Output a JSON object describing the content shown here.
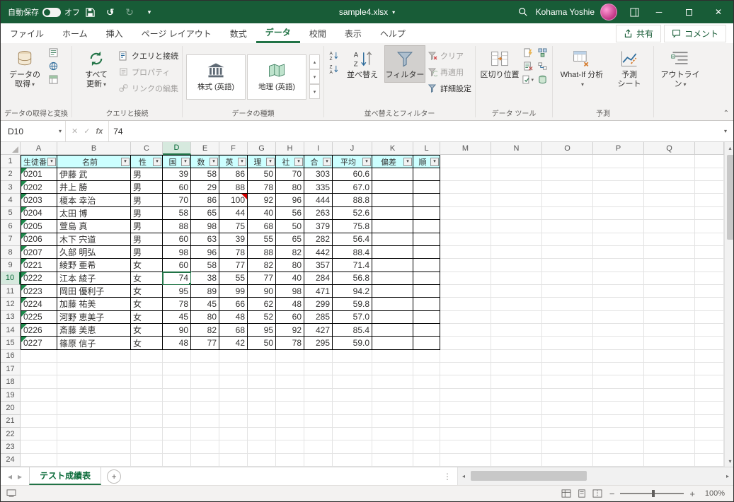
{
  "title_bar": {
    "autosave_label": "自動保存",
    "autosave_state": "オフ",
    "filename": "sample4.xlsx",
    "user_name": "Kohama Yoshie"
  },
  "ribbon_tabs": {
    "file": "ファイル",
    "tabs": [
      "ホーム",
      "挿入",
      "ページ レイアウト",
      "数式",
      "データ",
      "校閲",
      "表示",
      "ヘルプ"
    ],
    "active": "データ",
    "share_label": "共有",
    "comments_label": "コメント"
  },
  "ribbon": {
    "g1_label": "データの取得と変換",
    "get_data_l1": "データの",
    "get_data_l2": "取得",
    "g2_label": "クエリと接続",
    "refresh_l1": "すべて",
    "refresh_l2": "更新",
    "queries_connections": "クエリと接続",
    "properties": "プロパティ",
    "edit_links": "リンクの編集",
    "g3_label": "データの種類",
    "stocks": "株式 (英語)",
    "geography": "地理 (英語)",
    "g4_label": "並べ替えとフィルター",
    "sort": "並べ替え",
    "filter": "フィルター",
    "clear": "クリア",
    "reapply": "再適用",
    "advanced": "詳細設定",
    "g5_label": "データ ツール",
    "text_to_columns": "区切り位置",
    "g6_label": "予測",
    "whatif": "What-If 分析",
    "forecast_l1": "予測",
    "forecast_l2": "シート",
    "outline_l1": "アウトライ",
    "outline_l2": "ン"
  },
  "formula_bar": {
    "name_box": "D10",
    "cancel": "✕",
    "enter": "✓",
    "fx": "fx",
    "value": "74"
  },
  "grid": {
    "col_letters": [
      "A",
      "B",
      "C",
      "D",
      "E",
      "F",
      "G",
      "H",
      "I",
      "J",
      "K",
      "L",
      "M",
      "N",
      "O",
      "P",
      "Q",
      ""
    ],
    "num_rows": 24,
    "filter_headers": [
      "生徒番",
      "名前",
      "性",
      "国",
      "数",
      "英",
      "理",
      "社",
      "合",
      "平均",
      "偏差",
      "順"
    ],
    "rows": [
      [
        "0201",
        "伊藤 武",
        "男",
        "39",
        "58",
        "86",
        "50",
        "70",
        "303",
        "60.6"
      ],
      [
        "0202",
        "井上 勝",
        "男",
        "60",
        "29",
        "88",
        "78",
        "80",
        "335",
        "67.0"
      ],
      [
        "0203",
        "榎本 幸治",
        "男",
        "70",
        "86",
        "100",
        "92",
        "96",
        "444",
        "88.8"
      ],
      [
        "0204",
        "太田 博",
        "男",
        "58",
        "65",
        "44",
        "40",
        "56",
        "263",
        "52.6"
      ],
      [
        "0205",
        "萱島 真",
        "男",
        "88",
        "98",
        "75",
        "68",
        "50",
        "379",
        "75.8"
      ],
      [
        "0206",
        "木下 宍道",
        "男",
        "60",
        "63",
        "39",
        "55",
        "65",
        "282",
        "56.4"
      ],
      [
        "0207",
        "久部 明弘",
        "男",
        "98",
        "96",
        "78",
        "88",
        "82",
        "442",
        "88.4"
      ],
      [
        "0221",
        "綾野 亜希",
        "女",
        "60",
        "58",
        "77",
        "82",
        "80",
        "357",
        "71.4"
      ],
      [
        "0222",
        "江本 綾子",
        "女",
        "74",
        "38",
        "55",
        "77",
        "40",
        "284",
        "56.8"
      ],
      [
        "0223",
        "岡田 優利子",
        "女",
        "95",
        "89",
        "99",
        "90",
        "98",
        "471",
        "94.2"
      ],
      [
        "0224",
        "加藤 祐美",
        "女",
        "78",
        "45",
        "66",
        "62",
        "48",
        "299",
        "59.8"
      ],
      [
        "0225",
        "河野 恵美子",
        "女",
        "45",
        "80",
        "48",
        "52",
        "60",
        "285",
        "57.0"
      ],
      [
        "0226",
        "斎藤 美恵",
        "女",
        "90",
        "82",
        "68",
        "95",
        "92",
        "427",
        "85.4"
      ],
      [
        "0227",
        "篠原 信子",
        "女",
        "48",
        "77",
        "42",
        "50",
        "78",
        "295",
        "59.0"
      ]
    ],
    "selected": {
      "cell": "D10",
      "col": "D",
      "row": 10
    },
    "comment_cell": {
      "col": "F",
      "row": 4
    }
  },
  "sheet_bar": {
    "tab": "テスト成績表"
  },
  "status_bar": {
    "zoom": "100%"
  },
  "colors": {
    "accent": "#217346",
    "titlebar": "#185c37",
    "header_fill": "#ccffff"
  }
}
